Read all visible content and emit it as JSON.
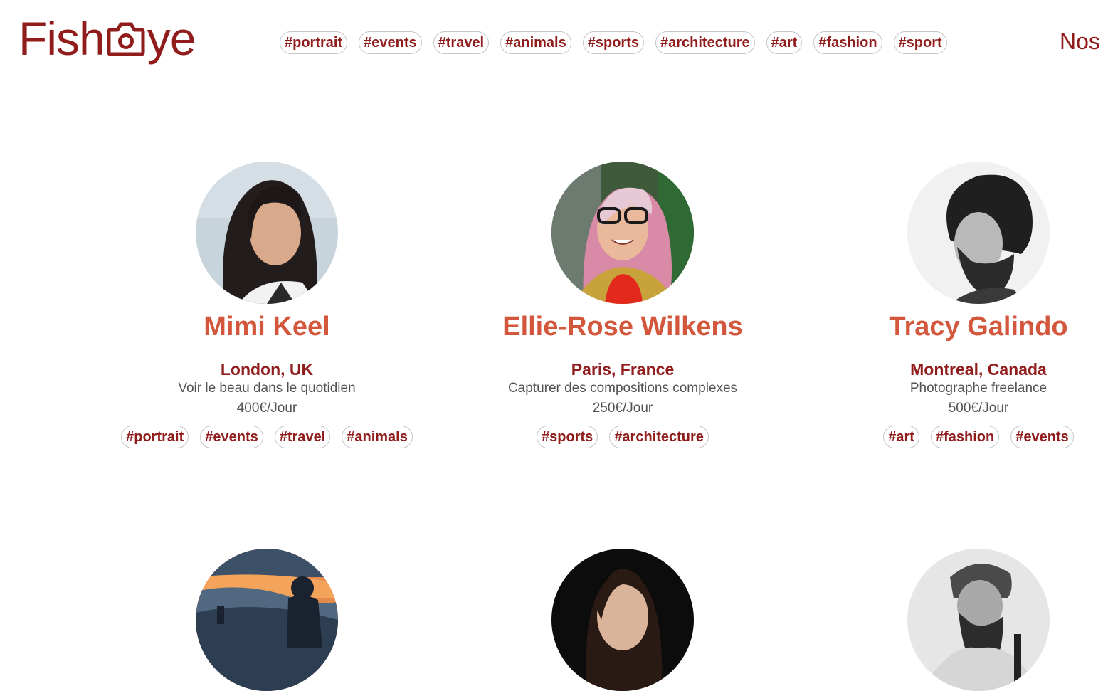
{
  "logo": {
    "text_before": "Fish",
    "text_after": "ye",
    "icon": "camera-icon"
  },
  "nav": {
    "tags": [
      "#portrait",
      "#events",
      "#travel",
      "#animals",
      "#sports",
      "#architecture",
      "#art",
      "#fashion",
      "#sport"
    ],
    "heading": "Nos"
  },
  "photographers": [
    {
      "name": "Mimi Keel",
      "location": "London, UK",
      "tagline": "Voir le beau dans le quotidien",
      "price": "400€/Jour",
      "tags": [
        "#portrait",
        "#events",
        "#travel",
        "#animals"
      ]
    },
    {
      "name": "Ellie-Rose Wilkens",
      "location": "Paris, France",
      "tagline": "Capturer des compositions complexes",
      "price": "250€/Jour",
      "tags": [
        "#sports",
        "#architecture"
      ]
    },
    {
      "name": "Tracy Galindo",
      "location": "Montreal, Canada",
      "tagline": "Photographe freelance",
      "price": "500€/Jour",
      "tags": [
        "#art",
        "#fashion",
        "#events"
      ]
    },
    {
      "name": "",
      "location": "",
      "tagline": "",
      "price": "",
      "tags": []
    },
    {
      "name": "",
      "location": "",
      "tagline": "",
      "price": "",
      "tags": []
    },
    {
      "name": "",
      "location": "",
      "tagline": "",
      "price": "",
      "tags": []
    }
  ],
  "colors": {
    "brand": "#901C1C",
    "name": "#D3573C",
    "text": "#525252",
    "tag_border": "#c6c6c6"
  }
}
